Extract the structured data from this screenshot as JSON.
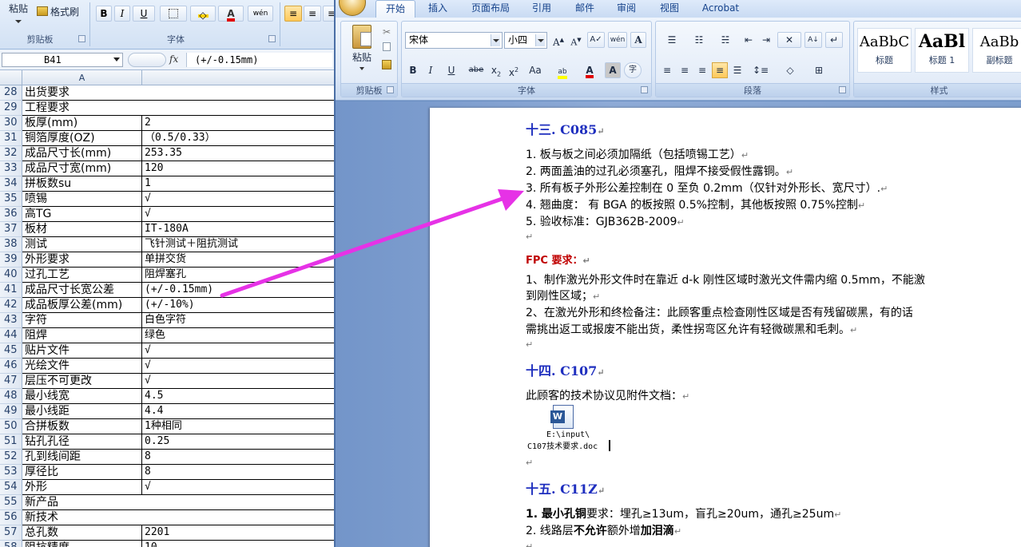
{
  "excel": {
    "clipboard_group": {
      "paste_label": "粘贴",
      "format_painter_label": "格式刷",
      "group_label": "剪贴板"
    },
    "font_group": {
      "bold": "B",
      "italic": "I",
      "underline": "U",
      "phonetic": "wén",
      "group_label": "字体"
    },
    "namebox": "B41",
    "fx_label": "fx",
    "formula_value": "(+/-0.15mm)",
    "column_headers": [
      "A"
    ],
    "rows": [
      {
        "n": "28",
        "a": "出货要求",
        "b": ""
      },
      {
        "n": "29",
        "a": "工程要求",
        "b": ""
      },
      {
        "n": "30",
        "a": "板厚(mm)",
        "b": "2"
      },
      {
        "n": "31",
        "a": "铜箔厚度(OZ)",
        "b": "（0.5/0.33）"
      },
      {
        "n": "32",
        "a": "成品尺寸长(mm)",
        "b": "253.35"
      },
      {
        "n": "33",
        "a": "成品尺寸宽(mm)",
        "b": "120"
      },
      {
        "n": "34",
        "a": "拼板数su",
        "b": "1"
      },
      {
        "n": "35",
        "a": "喷锡",
        "b": "√"
      },
      {
        "n": "36",
        "a": "高TG",
        "b": "√"
      },
      {
        "n": "37",
        "a": "板材",
        "b": "IT-180A"
      },
      {
        "n": "38",
        "a": "测试",
        "b": "飞针测试＋阻抗测试"
      },
      {
        "n": "39",
        "a": "外形要求",
        "b": "单拼交货"
      },
      {
        "n": "40",
        "a": "过孔工艺",
        "b": "阻焊塞孔"
      },
      {
        "n": "41",
        "a": "成品尺寸长宽公差",
        "b": "(+/-0.15mm)"
      },
      {
        "n": "42",
        "a": "成品板厚公差(mm)",
        "b": "(+/-10%)"
      },
      {
        "n": "43",
        "a": "字符",
        "b": "白色字符"
      },
      {
        "n": "44",
        "a": "阻焊",
        "b": "绿色"
      },
      {
        "n": "45",
        "a": "贴片文件",
        "b": "√"
      },
      {
        "n": "46",
        "a": "光绘文件",
        "b": "√"
      },
      {
        "n": "47",
        "a": "层压不可更改",
        "b": "√"
      },
      {
        "n": "48",
        "a": "最小线宽",
        "b": "4.5"
      },
      {
        "n": "49",
        "a": "最小线距",
        "b": "4.4"
      },
      {
        "n": "50",
        "a": "合拼板数",
        "b": "1种相同"
      },
      {
        "n": "51",
        "a": "钻孔孔径",
        "b": "0.25"
      },
      {
        "n": "52",
        "a": "孔到线间距",
        "b": "8"
      },
      {
        "n": "53",
        "a": "厚径比",
        "b": "8"
      },
      {
        "n": "54",
        "a": "外形",
        "b": "√"
      },
      {
        "n": "55",
        "a": "新产品",
        "b": ""
      },
      {
        "n": "56",
        "a": "新技术",
        "b": ""
      },
      {
        "n": "57",
        "a": "总孔数",
        "b": "2201"
      },
      {
        "n": "58",
        "a": "阻抗精度",
        "b": "10"
      }
    ]
  },
  "word": {
    "tabs": [
      "开始",
      "插入",
      "页面布局",
      "引用",
      "邮件",
      "审阅",
      "视图",
      "Acrobat"
    ],
    "active_tab": "开始",
    "clipboard_group": {
      "paste_label": "粘贴",
      "group_label": "剪贴板"
    },
    "font_group": {
      "font_name": "宋体",
      "font_size": "小四",
      "group_label": "字体",
      "bold": "B",
      "italic": "I",
      "underline": "U",
      "strike": "abe",
      "aa": "Aa"
    },
    "paragraph_group": {
      "group_label": "段落"
    },
    "styles_group": {
      "group_label": "样式",
      "styles": [
        {
          "sample": "AaBbC",
          "name": "标题"
        },
        {
          "sample": "AaBl",
          "name": "标题 1"
        },
        {
          "sample": "AaBb",
          "name": "副标题"
        }
      ]
    },
    "document": {
      "heading_13": "十三. C085",
      "list_13": [
        "1. 板与板之间必须加隔纸（包括喷锡工艺）",
        "2. 两面盖油的过孔必须塞孔，阻焊不接受假性露铜。",
        "3. 所有板子外形公差控制在 0 至负 0.2mm（仅针对外形长、宽尺寸）.",
        "4. 翘曲度： 有 BGA 的板按照 0.5%控制，其他板按照 0.75%控制",
        "5. 验收标准：GJB362B-2009"
      ],
      "fpc_title": "FPC 要求：",
      "fpc_lines": [
        "1、制作激光外形文件时在靠近 d-k 刚性区域时激光文件需内缩 0.5mm，不能激",
        "到刚性区域；",
        "2、在激光外形和终检备注：此顾客重点检查刚性区域是否有残留碳黑，有的话",
        "需挑出返工或报废不能出货，柔性拐弯区允许有轻微碳黑和毛刺。"
      ],
      "heading_14": "十四. C107",
      "c107_text": "此顾客的技术协议见附件文档：",
      "attachment_path": "E:\\input\\",
      "attachment_name": "C107技术要求.doc",
      "heading_15": "十五. C11Z",
      "list_15_1_bold": "1. 最小孔铜",
      "list_15_1_rest": "要求：埋孔≥13um，盲孔≥20um，通孔≥25um",
      "list_15_2_pre": "2. 线路层",
      "list_15_2_bold1": "不允许",
      "list_15_2_mid": "额外增",
      "list_15_2_bold2": "加泪滴"
    }
  },
  "arrow_color": "#e632e6"
}
